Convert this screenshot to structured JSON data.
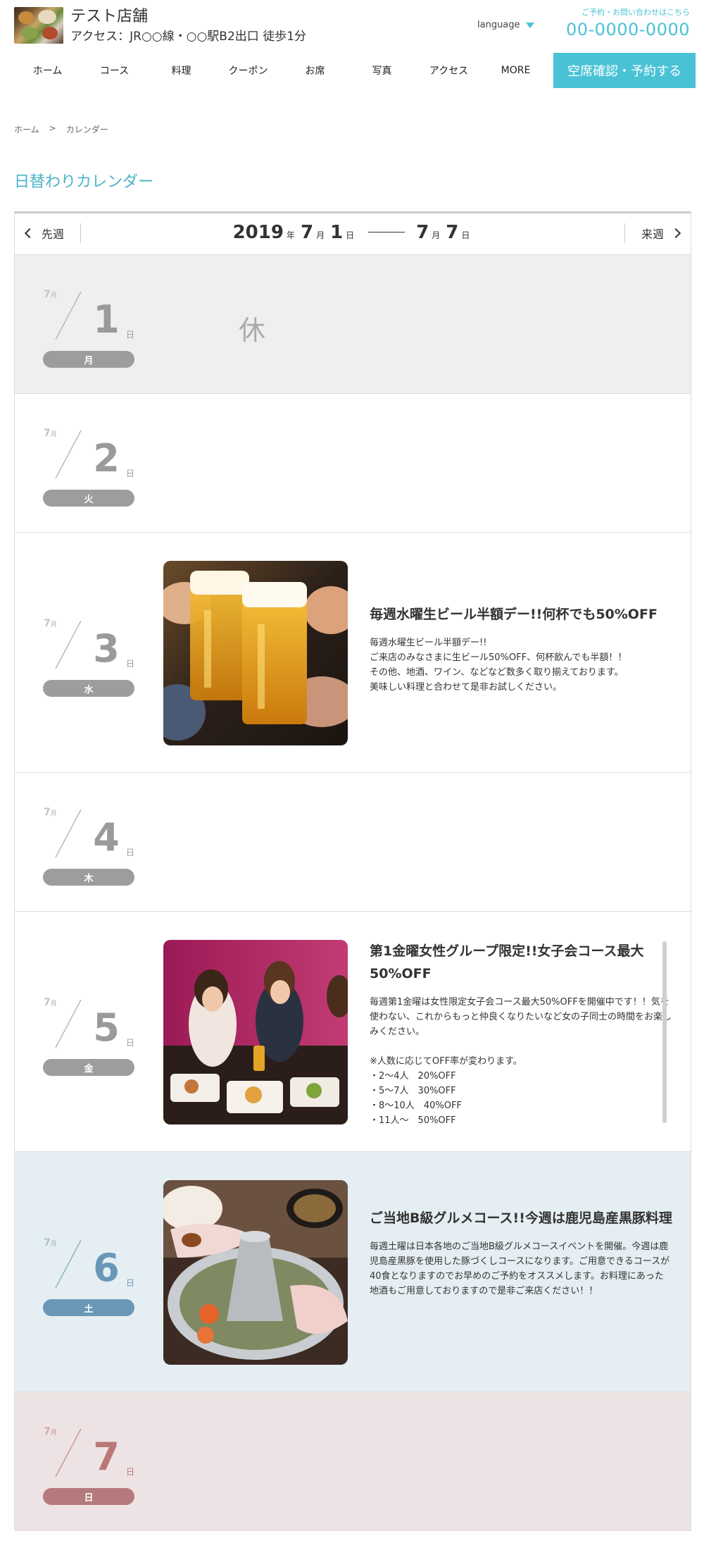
{
  "header": {
    "shop_name": "テスト店舗",
    "access": "アクセス：JR○○線・○○駅B2出口 徒歩1分",
    "language_label": "language",
    "contact_label": "ご予約・お問い合わせはこちら",
    "phone": "00-0000-0000",
    "reserve_label": "空席確認・予約する",
    "nav": [
      "ホーム",
      "コース",
      "料理",
      "クーポン",
      "お席",
      "写真",
      "アクセス",
      "MORE"
    ]
  },
  "breadcrumb": {
    "home": "ホーム",
    "separator": ">",
    "current": "カレンダー"
  },
  "page_title": "日替わりカレンダー",
  "week": {
    "prev_label": "先週",
    "next_label": "来週",
    "start_year": "2019",
    "year_unit": "年",
    "month_unit": "月",
    "day_unit": "日",
    "start_month": "7",
    "start_day": "1",
    "end_month": "7",
    "end_day": "7"
  },
  "days": [
    {
      "month": "7",
      "month_unit": "月",
      "day": "1",
      "day_unit": "日",
      "weekday": "月",
      "closed_mark": "休"
    },
    {
      "month": "7",
      "month_unit": "月",
      "day": "2",
      "day_unit": "日",
      "weekday": "火"
    },
    {
      "month": "7",
      "month_unit": "月",
      "day": "3",
      "day_unit": "日",
      "weekday": "水",
      "event_title": "毎週水曜生ビール半額デー!!何杯でも50%OFF",
      "event_desc": "毎週水曜生ビール半額デー!!\nご来店のみなさまに生ビール50%OFF、何杯飲んでも半額！！\nその他、地酒、ワイン、などなど数多く取り揃えております。\n美味しい料理と合わせて是非お試しください。"
    },
    {
      "month": "7",
      "month_unit": "月",
      "day": "4",
      "day_unit": "日",
      "weekday": "木"
    },
    {
      "month": "7",
      "month_unit": "月",
      "day": "5",
      "day_unit": "日",
      "weekday": "金",
      "event_title": "第1金曜女性グループ限定!!女子会コース最大50%OFF",
      "event_desc": "毎週第1金曜は女性限定女子会コース最大50%OFFを開催中です！！気を使わない、これからもっと仲良くなりたいなど女の子同士の時間をお楽しみください。\n\n※人数に応じてOFF率が変わります。\n・2〜4人　20%OFF\n・5〜7人　30%OFF\n・8〜10人　40%OFF\n・11人〜　50%OFF"
    },
    {
      "month": "7",
      "month_unit": "月",
      "day": "6",
      "day_unit": "日",
      "weekday": "土",
      "event_title": "ご当地B級グルメコース!!今週は鹿児島産黒豚料理",
      "event_desc": "毎週土曜は日本各地のご当地B級グルメコースイベントを開催。今週は鹿児島産黒豚を使用した豚づくしコースになります。ご用意できるコースが40食となりますのでお早めのご予約をオススメします。お料理にあった地酒もご用意しておりますので是非ご来店ください！！"
    },
    {
      "month": "7",
      "month_unit": "月",
      "day": "7",
      "day_unit": "日",
      "weekday": "日"
    }
  ],
  "colors": {
    "accent": "#4ac2d6",
    "title": "#4ab3c8",
    "weekday_gray": "#9d9d9d",
    "saturday_blue": "#6b97b6",
    "sunday_red": "#b57a7b",
    "closed_bg": "#efefef",
    "saturday_bg": "#e5eef2",
    "sunday_bg": "#eee3e4"
  }
}
